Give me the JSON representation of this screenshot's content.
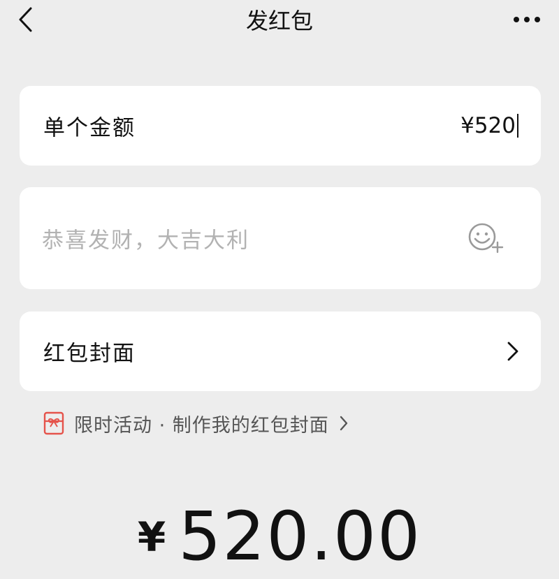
{
  "nav": {
    "title": "发红包",
    "back_icon": "chevron-left-icon",
    "more_icon": "more-dots-icon"
  },
  "amount_row": {
    "label": "单个金额",
    "value": "¥520"
  },
  "greeting": {
    "placeholder": "恭喜发财，大吉大利",
    "emoji_icon": "emoji-add-icon"
  },
  "cover_row": {
    "label": "红包封面",
    "chevron_icon": "chevron-right-icon"
  },
  "promo": {
    "icon": "gift-envelope-icon",
    "text": "限时活动 · 制作我的红包封面",
    "accent_color": "#e5534b"
  },
  "total": {
    "symbol": "¥",
    "amount": "520.00"
  }
}
